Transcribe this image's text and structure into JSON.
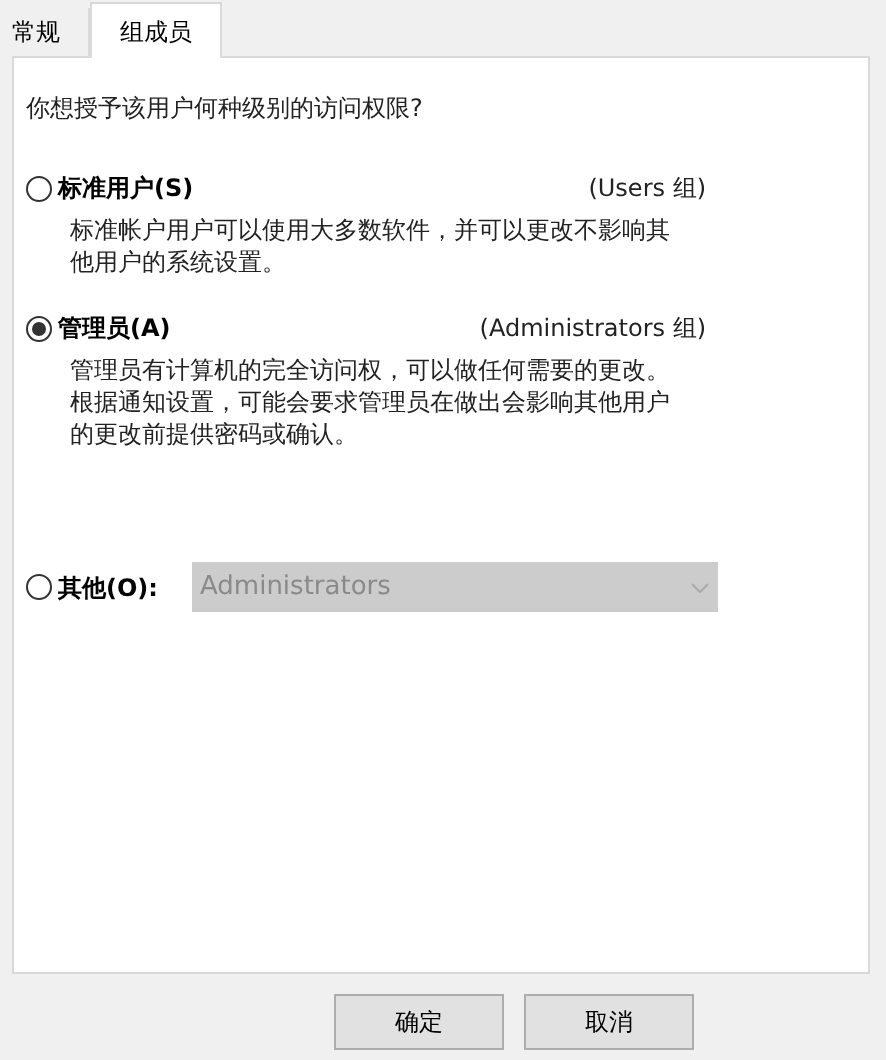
{
  "tabs": [
    {
      "label": "常规",
      "selected": false
    },
    {
      "label": "组成员",
      "selected": true
    }
  ],
  "question": "你想授予该用户何种级别的访问权限?",
  "options": [
    {
      "kind": "described",
      "label": "标准用户(S)",
      "group": "(Users 组)",
      "description": "标准帐户用户可以使用大多数软件，并可以更改不影响其他用户的系统设置。",
      "selected": false
    },
    {
      "kind": "described",
      "label": "管理员(A)",
      "group": "(Administrators 组)",
      "description": "管理员有计算机的完全访问权，可以做任何需要的更改。根据通知设置，可能会要求管理员在做出会影响其他用户的更改前提供密码或确认。",
      "selected": true
    },
    {
      "kind": "dropdown",
      "label": "其他(O):",
      "value": "Administrators",
      "disabled": true,
      "selected": false
    }
  ],
  "buttons": [
    "确定",
    "取消"
  ]
}
